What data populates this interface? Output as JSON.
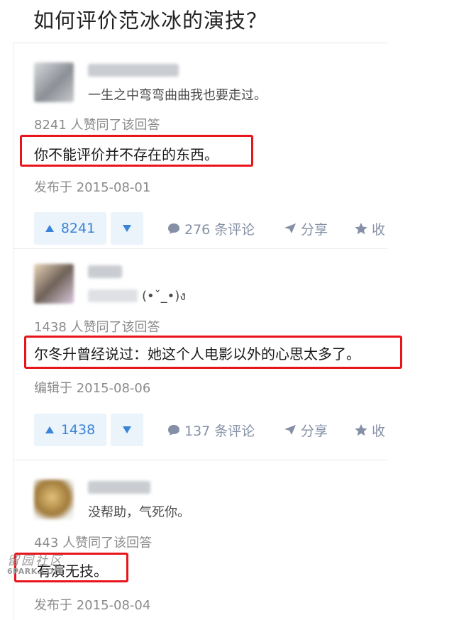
{
  "question": {
    "title": "如何评价范冰冰的演技？"
  },
  "answers": [
    {
      "bio": "一生之中弯弯曲曲我也要走过。",
      "votes_text": "8241 人赞同了该回答",
      "content": "你不能评价并不存在的东西。",
      "date": "发布于 2015-08-01",
      "upvote_count": "8241",
      "comments": "276 条评论",
      "share": "分享",
      "collect": "收"
    },
    {
      "bio": "(•ˇ_•)ง",
      "votes_text": "1438 人赞同了该回答",
      "content": "尔冬升曾经说过：她这个人电影以外的心思太多了。",
      "date": "编辑于 2015-08-06",
      "upvote_count": "1438",
      "comments": "137 条评论",
      "share": "分享",
      "collect": "收"
    },
    {
      "bio": "没帮助，气死你。",
      "votes_text": "443 人赞同了该回答",
      "content": "有演无技。",
      "date": "发布于 2015-08-04"
    }
  ],
  "watermark": {
    "cn": "留园社区",
    "en": "6PARK.COM"
  },
  "colors": {
    "highlight": "#e8141b",
    "vote_blue": "#3a84d8",
    "vote_bg": "#ebf3fb",
    "meta_gray": "#8590a6"
  },
  "icons": [
    "upvote-triangle-icon",
    "downvote-triangle-icon",
    "comment-bubble-icon",
    "share-plane-icon",
    "star-icon"
  ]
}
